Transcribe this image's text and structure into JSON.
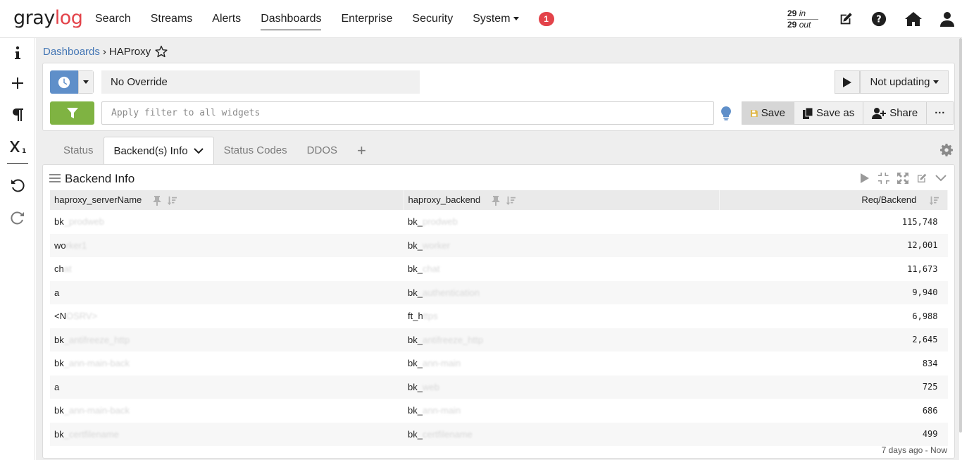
{
  "nav": {
    "logo_prefix": "gray",
    "logo_suffix": "log",
    "items": [
      "Search",
      "Streams",
      "Alerts",
      "Dashboards",
      "Enterprise",
      "Security",
      "System"
    ],
    "active": "Dashboards",
    "notification_count": "1",
    "throughput_in": "29",
    "throughput_in_label": "in",
    "throughput_out": "29",
    "throughput_out_label": "out"
  },
  "breadcrumb": {
    "parent": "Dashboards",
    "separator": "›",
    "current": "HAProxy"
  },
  "query": {
    "time_override": "No Override",
    "refresh_status": "Not updating",
    "filter_placeholder": "Apply filter to all widgets",
    "save_label": "Save",
    "save_as_label": "Save as",
    "share_label": "Share",
    "more_label": "···"
  },
  "tabs": {
    "items": [
      "Status",
      "Backend(s) Info",
      "Status Codes",
      "DDOS"
    ],
    "active_index": 1,
    "add_label": "+"
  },
  "widget": {
    "title": "Backend Info",
    "columns": [
      "haproxy_serverName",
      "haproxy_backend",
      "Req/Backend"
    ],
    "rows": [
      {
        "server_visible": "bk",
        "server_hidden": "_prodweb",
        "backend_visible": "bk_",
        "backend_hidden": "prodweb",
        "value": "115,748"
      },
      {
        "server_visible": "wo",
        "server_hidden": "rker1",
        "backend_visible": "bk_",
        "backend_hidden": "worker",
        "value": "12,001"
      },
      {
        "server_visible": "ch",
        "server_hidden": "at",
        "backend_visible": "bk_",
        "backend_hidden": "chat",
        "value": "11,673"
      },
      {
        "server_visible": "a",
        "server_hidden": "",
        "backend_visible": "bk_",
        "backend_hidden": "authentication",
        "value": "9,940"
      },
      {
        "server_visible": "<N",
        "server_hidden": "OSRV>",
        "backend_visible": "ft_h",
        "backend_hidden": "ttps",
        "value": "6,988"
      },
      {
        "server_visible": "bk",
        "server_hidden": "_antifreeze_http",
        "backend_visible": "bk_",
        "backend_hidden": "antifreeze_http",
        "value": "2,645"
      },
      {
        "server_visible": "bk",
        "server_hidden": "_ann-main-back",
        "backend_visible": "bk_",
        "backend_hidden": "ann-main",
        "value": "834"
      },
      {
        "server_visible": "a",
        "server_hidden": "",
        "backend_visible": "bk_",
        "backend_hidden": "web",
        "value": "725"
      },
      {
        "server_visible": "bk",
        "server_hidden": "_ann-main-back",
        "backend_visible": "bk_",
        "backend_hidden": "ann-main",
        "value": "686"
      },
      {
        "server_visible": "bk",
        "server_hidden": "_certfilename",
        "backend_visible": "bk_",
        "backend_hidden": "certfilename",
        "value": "499"
      }
    ],
    "time_range": "7 days ago - Now"
  },
  "colors": {
    "brand_red": "#e3434a",
    "primary_blue": "#5f8fc9",
    "filter_green": "#7fb342",
    "link_blue": "#4577b5"
  }
}
